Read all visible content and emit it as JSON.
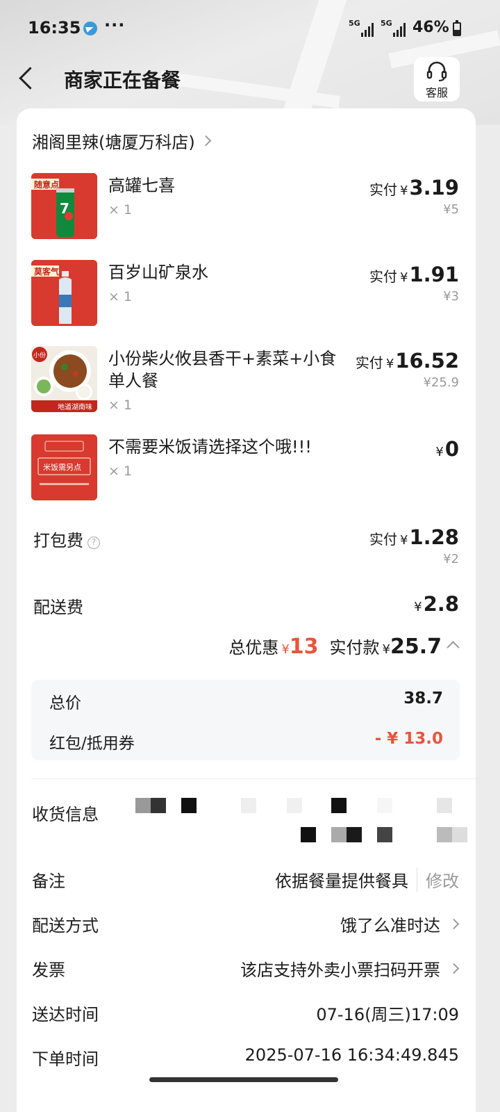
{
  "status_bar": {
    "time": "16:35",
    "more": "···",
    "signal_1": "5G",
    "signal_2": "5G",
    "battery": "46%",
    "battery_level": 0.46,
    "telegram_icon": "telegram-icon"
  },
  "header": {
    "title": "商家正在备餐",
    "back_icon": "back-arrow-icon",
    "support_icon": "headset-icon",
    "support_label": "客服"
  },
  "shop": {
    "name": "湘阁里辣(塘厦万科店)"
  },
  "items": [
    {
      "name": "高罐七喜",
      "qty": "× 1",
      "paid_label": "实付",
      "currency": "¥",
      "paid": "3.19",
      "original": "¥5",
      "thumb_tag": "随意点",
      "thumb_icon": "7up-can-image"
    },
    {
      "name": "百岁山矿泉水",
      "qty": "× 1",
      "paid_label": "实付",
      "currency": "¥",
      "paid": "1.91",
      "original": "¥3",
      "thumb_tag": "莫客气",
      "thumb_icon": "water-bottle-image"
    },
    {
      "name": "小份柴火攸县香干+素菜+小食单人餐",
      "qty": "× 1",
      "paid_label": "实付",
      "currency": "¥",
      "paid": "16.52",
      "original": "¥25.9",
      "thumb_tag": "小份",
      "thumb_caption": "地道湖南味",
      "thumb_icon": "meal-bowl-image"
    },
    {
      "name": "不需要米饭请选择这个哦!!!",
      "qty": "× 1",
      "currency": "¥",
      "paid": "0",
      "thumb_tag": "米饭需另点",
      "thumb_icon": "rice-notice-image"
    }
  ],
  "fees": {
    "packing": {
      "label": "打包费",
      "help_icon": "question-circle-icon",
      "paid_label": "实付",
      "currency": "¥",
      "paid": "1.28",
      "original": "¥2"
    },
    "delivery": {
      "label": "配送费",
      "currency": "¥",
      "amount": "2.8"
    }
  },
  "totals": {
    "discount_label": "总优惠",
    "currency": "¥",
    "discount": "13",
    "paid_label": "实付款",
    "paid": "25.7",
    "collapse_icon": "chevron-up-icon"
  },
  "breakdown": {
    "total_label": "总价",
    "total": "38.7",
    "coupon_label": "红包/抵用券",
    "coupon": "- ¥ 13.0"
  },
  "info": {
    "address_label": "收货信息",
    "note_label": "备注",
    "note_value": "依据餐量提供餐具",
    "note_action": "修改",
    "delivery_method_label": "配送方式",
    "delivery_method_value": "饿了么准时达",
    "invoice_label": "发票",
    "invoice_value": "该店支持外卖小票扫码开票",
    "arrival_label": "送达时间",
    "arrival_value": "07-16(周三)17:09",
    "order_time_label": "下单时间",
    "order_time_value": "2025-07-16 16:34:49.845"
  },
  "colors": {
    "accent_red": "#e8553d",
    "product_red": "#d83a2f",
    "muted_text": "#9a9a9a"
  }
}
